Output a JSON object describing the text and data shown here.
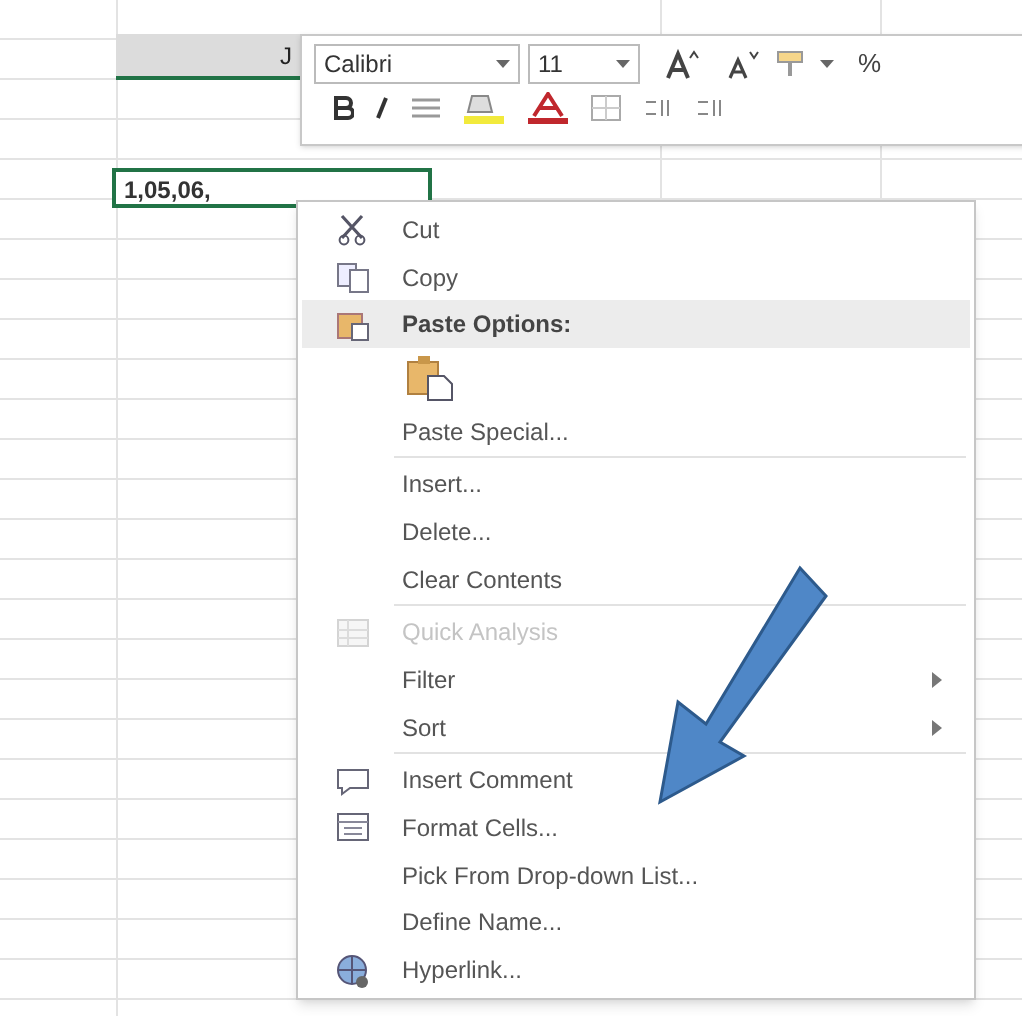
{
  "column_header": {
    "label": "J"
  },
  "mini_toolbar": {
    "font": "Calibri",
    "size": "11",
    "percent": "%"
  },
  "cell": {
    "value": "1,05,06,"
  },
  "context_menu": {
    "items": [
      {
        "kind": "cut",
        "label": "Cut",
        "selected": false,
        "disabled": false
      },
      {
        "kind": "copy",
        "label": "Copy",
        "selected": false,
        "disabled": false
      },
      {
        "kind": "paste",
        "label": "Paste Options:",
        "selected": true,
        "disabled": false
      },
      {
        "kind": "pastebutton"
      },
      {
        "kind": "plain",
        "label": "Paste Special...",
        "selected": false,
        "disabled": false
      },
      {
        "kind": "separator"
      },
      {
        "kind": "plain",
        "label": "Insert...",
        "selected": false,
        "disabled": false
      },
      {
        "kind": "plain",
        "label": "Delete...",
        "selected": false,
        "disabled": false
      },
      {
        "kind": "plain",
        "label": "Clear Contents",
        "selected": false,
        "disabled": false
      },
      {
        "kind": "separator"
      },
      {
        "kind": "analysis",
        "label": "Quick Analysis",
        "selected": false,
        "disabled": true
      },
      {
        "kind": "plain",
        "label": "Filter",
        "selected": false,
        "disabled": false,
        "submenu": true
      },
      {
        "kind": "plain",
        "label": "Sort",
        "selected": false,
        "disabled": false,
        "submenu": true
      },
      {
        "kind": "separator"
      },
      {
        "kind": "comment",
        "label": "Insert Comment",
        "selected": false,
        "disabled": false
      },
      {
        "kind": "format",
        "label": "Format Cells...",
        "selected": false,
        "disabled": false
      },
      {
        "kind": "plain",
        "label": "Pick From Drop-down List...",
        "selected": false,
        "disabled": false
      },
      {
        "kind": "plain",
        "label": "Define Name...",
        "selected": false,
        "disabled": false
      },
      {
        "kind": "hyperlink",
        "label": "Hyperlink...",
        "selected": false,
        "disabled": false
      }
    ]
  }
}
